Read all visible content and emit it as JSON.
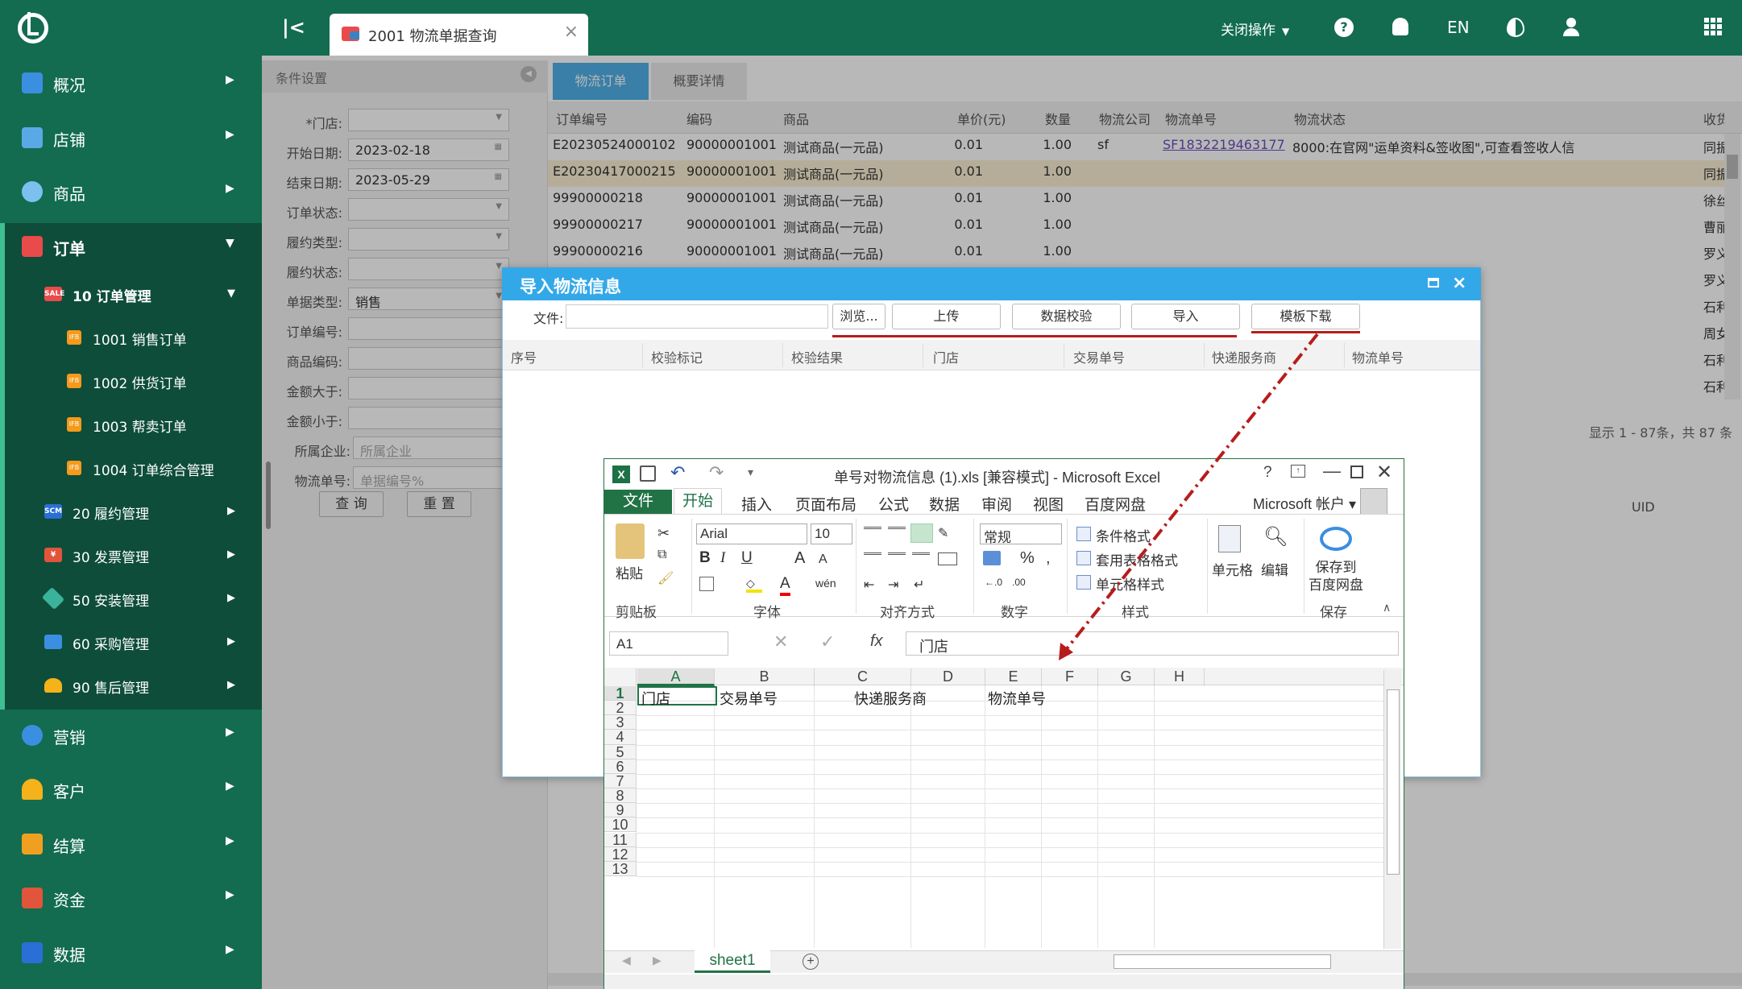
{
  "header": {
    "tab_title": "2001 物流单据查询",
    "close_ops": "关闭操作",
    "lang": "EN"
  },
  "sidebar": {
    "top_items": [
      {
        "label": "概况",
        "icon": "home-icon"
      },
      {
        "label": "店铺",
        "icon": "store-icon"
      },
      {
        "label": "商品",
        "icon": "goods-icon"
      },
      {
        "label": "订单",
        "icon": "sale-icon"
      }
    ],
    "order_sub": [
      {
        "label": "10 订单管理"
      },
      {
        "label": "20 履约管理"
      },
      {
        "label": "30 发票管理"
      },
      {
        "label": "50 安装管理"
      },
      {
        "label": "60 采购管理"
      },
      {
        "label": "90 售后管理"
      }
    ],
    "order_mgmt_items": [
      {
        "label": "1001 销售订单"
      },
      {
        "label": "1002 供货订单"
      },
      {
        "label": "1003 帮卖订单"
      },
      {
        "label": "1004 订单综合管理"
      }
    ],
    "bottom_items": [
      {
        "label": "营销"
      },
      {
        "label": "客户"
      },
      {
        "label": "结算"
      },
      {
        "label": "资金"
      },
      {
        "label": "数据"
      }
    ]
  },
  "conditions": {
    "title": "条件设置",
    "fields": [
      {
        "label": "*门店:",
        "value": "",
        "placeholder": ""
      },
      {
        "label": "开始日期:",
        "value": "2023-02-18"
      },
      {
        "label": "结束日期:",
        "value": "2023-05-29"
      },
      {
        "label": "订单状态:",
        "value": ""
      },
      {
        "label": "履约类型:",
        "value": ""
      },
      {
        "label": "履约状态:",
        "value": ""
      },
      {
        "label": "单据类型:",
        "value": "销售"
      },
      {
        "label": "订单编号:",
        "value": ""
      },
      {
        "label": "商品编码:",
        "value": ""
      },
      {
        "label": "金额大于:",
        "value": ""
      },
      {
        "label": "金额小于:",
        "value": ""
      },
      {
        "label": "所属企业:",
        "value": "",
        "placeholder": "所属企业"
      },
      {
        "label": "物流单号:",
        "value": "",
        "placeholder": "单据编号%"
      }
    ],
    "query_btn": "查 询",
    "reset_btn": "重 置"
  },
  "grid": {
    "tabs": [
      "物流订单",
      "概要详情"
    ],
    "columns": [
      "订单编号",
      "编码",
      "商品",
      "单价(元)",
      "数量",
      "物流公司",
      "物流单号",
      "物流状态",
      "收货人"
    ],
    "rows": [
      [
        "E20230524000102",
        "90000001001",
        "测试商品(一元品)",
        "0.01",
        "1.00",
        "sf",
        "SF1832219463177",
        "8000:在官网\"运单资料&签收图\",可查看签收人信",
        "同振"
      ],
      [
        "E20230417000215",
        "90000001001",
        "测试商品(一元品)",
        "0.01",
        "1.00",
        "",
        "",
        "",
        "同振"
      ],
      [
        "99900000218",
        "90000001001",
        "测试商品(一元品)",
        "0.01",
        "1.00",
        "",
        "",
        "",
        "徐丝"
      ],
      [
        "99900000217",
        "90000001001",
        "测试商品(一元品)",
        "0.01",
        "1.00",
        "",
        "",
        "",
        "曹丽"
      ],
      [
        "99900000216",
        "90000001001",
        "测试商品(一元品)",
        "0.01",
        "1.00",
        "",
        "",
        "",
        "罗义"
      ]
    ],
    "extra_consignees": [
      "罗义",
      "石利",
      "周女",
      "石利",
      "石利"
    ],
    "pager": "显示 1 - 87条，共 87 条",
    "uid_header": "UID"
  },
  "modal": {
    "title": "导入物流信息",
    "file_label": "文件:",
    "buttons": [
      "浏览...",
      "上传",
      "数据校验",
      "导入",
      "模板下载"
    ],
    "columns": [
      "序号",
      "校验标记",
      "校验结果",
      "门店",
      "交易单号",
      "快递服务商",
      "物流单号"
    ]
  },
  "excel": {
    "title": "单号对物流信息 (1).xls  [兼容模式] - Microsoft Excel",
    "tabs": [
      "文件",
      "开始",
      "插入",
      "页面布局",
      "公式",
      "数据",
      "审阅",
      "视图",
      "百度网盘"
    ],
    "account": "Microsoft 帐户",
    "font_name": "Arial",
    "font_size": "10",
    "number_format": "常规",
    "styles": [
      "条件格式",
      "套用表格格式",
      "单元格样式"
    ],
    "paste": "粘贴",
    "cells_btn": "单元格",
    "edit_btn": "编辑",
    "save_baidu": "保存到\n百度网盘",
    "groups": [
      "剪贴板",
      "字体",
      "对齐方式",
      "数字",
      "样式",
      "保存"
    ],
    "name_box": "A1",
    "formula": "门店",
    "columns": [
      "A",
      "B",
      "C",
      "D",
      "E",
      "F",
      "G",
      "H"
    ],
    "rows": [
      "1",
      "2",
      "3",
      "4",
      "5",
      "6",
      "7",
      "8",
      "9",
      "10",
      "11",
      "12",
      "13"
    ],
    "row1": [
      "门店",
      "交易单号",
      "快递服务商",
      "物流单号"
    ],
    "sheet": "sheet1"
  },
  "colors": {
    "brand": "#136c50",
    "accent": "#33a8e8",
    "excel": "#217346",
    "annotation": "#b71c1c"
  }
}
